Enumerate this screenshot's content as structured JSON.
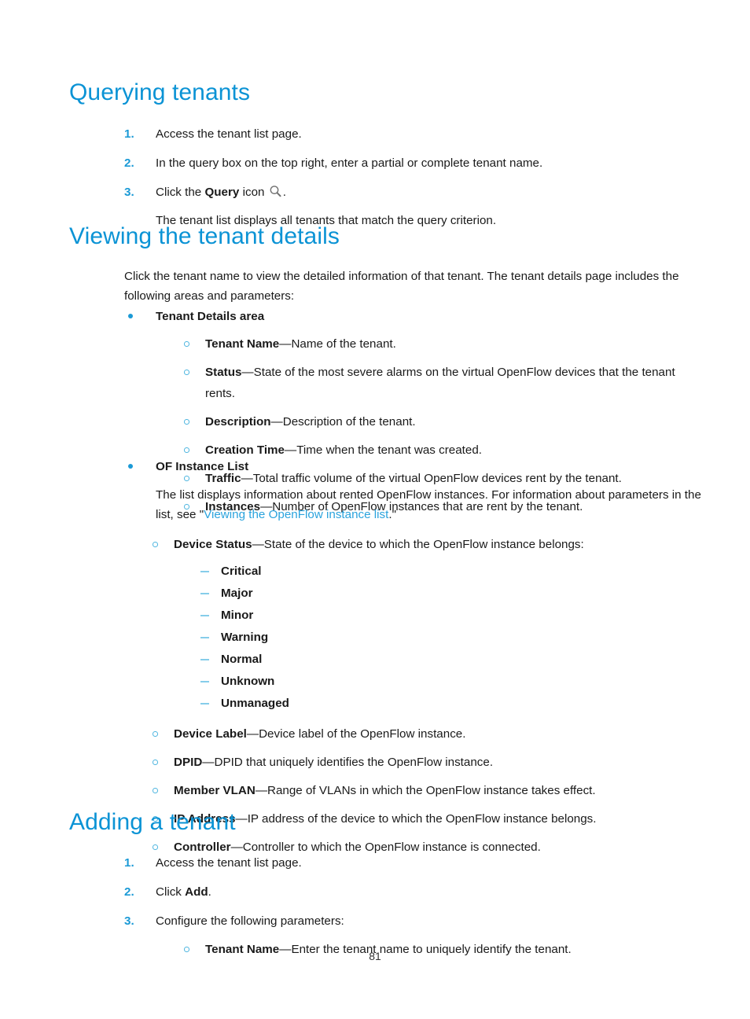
{
  "document": {
    "page_number": "81",
    "accent_color": "#0b93d5",
    "marker_color": "#1b9ad6",
    "link_color": "#2aa3dd",
    "text_color": "#1a1a1a"
  },
  "sections": {
    "querying_tenants": {
      "heading": "Querying tenants",
      "steps": [
        {
          "number": "1.",
          "text": "Access the tenant list page."
        },
        {
          "number": "2.",
          "text": "In the query box on the top right, enter a partial or complete tenant name."
        },
        {
          "number": "3.",
          "prefix": "Click the ",
          "bold": "Query",
          "suffix": " icon ",
          "icon": "search-icon",
          "tail": ".",
          "note": "The tenant list displays all tenants that match the query criterion."
        }
      ]
    },
    "viewing_tenant_details": {
      "heading": "Viewing the tenant details",
      "intro": "Click the tenant name to view the detailed information of that tenant. The tenant details page includes the following areas and parameters:",
      "tenant_details_area": {
        "label": "Tenant Details area",
        "params": [
          {
            "term": "Tenant Name",
            "dash": "—",
            "desc": "Name of the tenant."
          },
          {
            "term": "Status",
            "dash": "—",
            "desc": "State of the most severe alarms on the virtual OpenFlow devices that the tenant rents."
          },
          {
            "term": "Description",
            "dash": "—",
            "desc": "Description of the tenant."
          },
          {
            "term": "Creation Time",
            "dash": "—",
            "desc": "Time when the tenant was created."
          },
          {
            "term": "Traffic",
            "dash": "—",
            "desc": "Total traffic volume of the virtual OpenFlow devices rent by the tenant."
          },
          {
            "term": "Instances",
            "dash": "—",
            "desc": "Number of OpenFlow instances that are rent by the tenant."
          }
        ]
      },
      "of_instance_list": {
        "label": "OF Instance List",
        "intro_before": "The list displays information about rented OpenFlow instances. For information about parameters in the list, see \"",
        "link_text": "Viewing the OpenFlow instance list",
        "intro_after": ".\"",
        "device_status": {
          "term": "Device Status",
          "dash": "—",
          "desc": "State of the device to which the OpenFlow instance belongs:",
          "values": [
            "Critical",
            "Major",
            "Minor",
            "Warning",
            "Normal",
            "Unknown",
            "Unmanaged"
          ]
        },
        "params": [
          {
            "term": "Device Label",
            "dash": "—",
            "desc": "Device label of the OpenFlow instance."
          },
          {
            "term": "DPID",
            "dash": "—",
            "desc": "DPID that uniquely identifies the OpenFlow instance."
          },
          {
            "term": "Member VLAN",
            "dash": "—",
            "desc": "Range of VLANs in which the OpenFlow instance takes effect."
          },
          {
            "term": "IP Address",
            "dash": "—",
            "desc": "IP address of the device to which the OpenFlow instance belongs."
          },
          {
            "term": "Controller",
            "dash": "—",
            "desc": "Controller to which the OpenFlow instance is connected."
          }
        ]
      }
    },
    "adding_a_tenant": {
      "heading": "Adding a tenant",
      "steps": [
        {
          "number": "1.",
          "text": "Access the tenant list page."
        },
        {
          "number": "2.",
          "prefix": "Click ",
          "bold": "Add",
          "tail": "."
        },
        {
          "number": "3.",
          "text": "Configure the following parameters:"
        }
      ],
      "params": [
        {
          "term": "Tenant Name",
          "dash": "—",
          "desc": "Enter the tenant name to uniquely identify the tenant."
        }
      ]
    }
  }
}
